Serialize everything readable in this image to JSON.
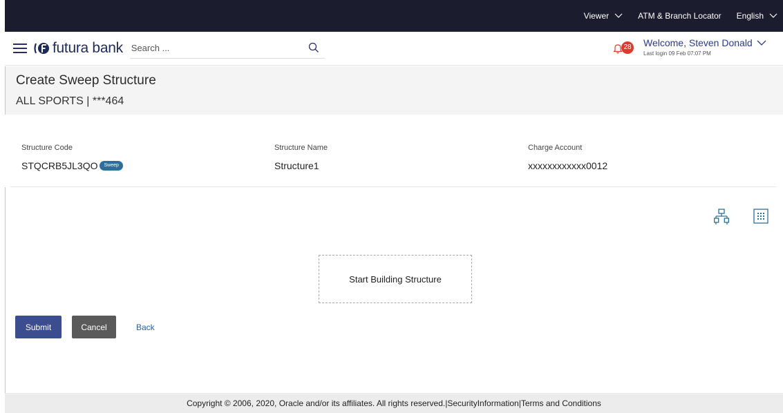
{
  "topbar": {
    "viewer_label": "Viewer",
    "locator_label": "ATM & Branch Locator",
    "language_label": "English"
  },
  "header": {
    "brand": "futura bank",
    "search_placeholder": "Search ...",
    "notification_count": "28",
    "welcome_text": "Welcome, Steven Donald",
    "last_login": "Last login 09 Feb 07:07 PM"
  },
  "page": {
    "title": "Create Sweep Structure",
    "subtitle": "ALL SPORTS | ***464"
  },
  "details": {
    "structure_code_label": "Structure Code",
    "structure_code_value": "STQCRB5JL3QO",
    "structure_code_badge": "Sweep",
    "structure_name_label": "Structure Name",
    "structure_name_value": "Structure1",
    "charge_account_label": "Charge Account",
    "charge_account_value": "xxxxxxxxxxxx0012"
  },
  "canvas": {
    "start_label": "Start Building Structure",
    "tree_view_icon": "hierarchy-icon",
    "grid_view_icon": "grid-icon"
  },
  "actions": {
    "submit_label": "Submit",
    "cancel_label": "Cancel",
    "back_label": "Back"
  },
  "footer": {
    "copyright": "Copyright © 2006, 2020, Oracle and/or its affiliates. All rights reserved.|SecurityInformation|Terms and Conditions"
  },
  "colors": {
    "topbar_bg": "#1b1c2e",
    "primary_button": "#3c4d8f",
    "secondary_button": "#5a5a5a",
    "badge_bg": "#e0392b",
    "sweep_badge_bg": "#2c6f9a",
    "link": "#2c5fa0"
  }
}
